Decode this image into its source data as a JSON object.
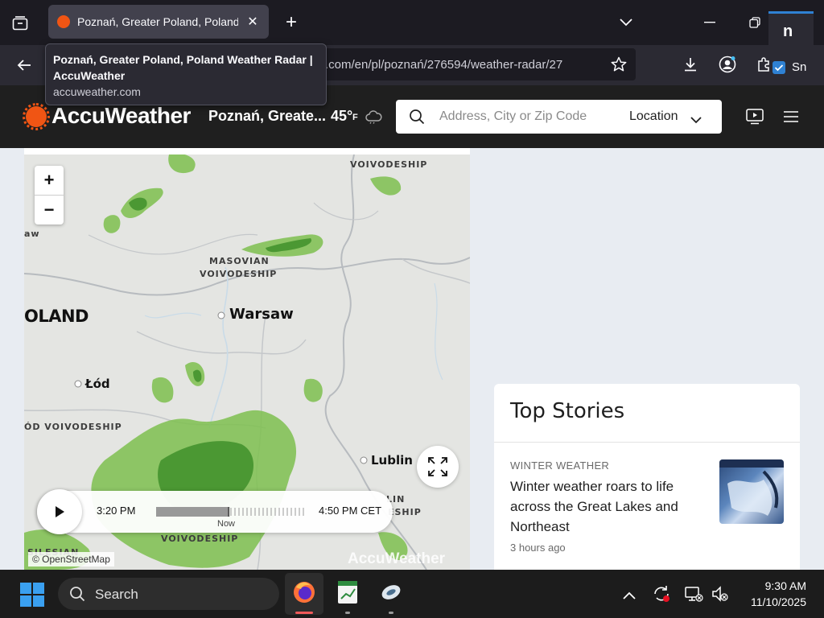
{
  "browser": {
    "tab_title": "Poznań, Greater Poland, Poland Weather Radar | AccuWeather",
    "tooltip_title": "Poznań, Greater Poland, Poland Weather Radar | AccuWeather",
    "tooltip_url": "accuweather.com",
    "url_visible": ".com/en/pl/poznań/276594/weather-radar/27",
    "ext_label": "Sn",
    "notion_label": "n"
  },
  "site": {
    "logo": "AccuWeather",
    "location": "Poznań, Greate...",
    "temp": "45°",
    "temp_unit": "F",
    "search_placeholder": "Address, City or Zip Code",
    "location_button": "Location"
  },
  "map": {
    "labels": {
      "voivodeship_top": "VOIVODESHIP",
      "masovian_1": "MASOVIAN",
      "masovian_2": "VOIVODESHIP",
      "warsaw": "Warsaw",
      "poland": "OLAND",
      "lodz": "Łód",
      "lodz_voiv": "ÓD VOIVODESHIP",
      "lublin": "Lublin",
      "left_edge": "aw",
      "bottom_voiv": "VOIVODESHIP",
      "silesian": "SILESIAN",
      "lin": "LIN",
      "eship": "ESHIP"
    },
    "player": {
      "start_time": "3:20 PM",
      "end_time": "4:50 PM CET",
      "now_label": "Now",
      "progress_fraction": 0.49
    },
    "attribution": "© OpenStreetMap",
    "watermark": "AccuWeather"
  },
  "top_stories": {
    "title": "Top Stories",
    "items": [
      {
        "category": "WINTER WEATHER",
        "headline": "Winter weather roars to life across the Great Lakes and Northeast",
        "time": "3 hours ago"
      }
    ]
  },
  "taskbar": {
    "search_label": "Search",
    "time": "9:30 AM",
    "date": "11/10/2025"
  },
  "colors": {
    "accent": "#f05514",
    "radar_green": "#5aa83a",
    "header_bg": "#1f1f1f"
  }
}
